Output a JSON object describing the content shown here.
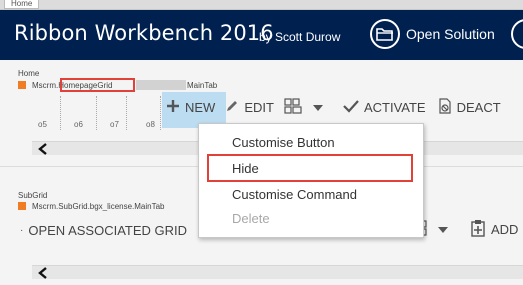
{
  "browser_tab": {
    "label": "Home"
  },
  "header": {
    "title": "Ribbon Workbench 2016",
    "byline": "by Scott Durow",
    "open_solution_label": "Open Solution"
  },
  "home_section": {
    "label": "Home",
    "id_prefix": "Mscrm.",
    "id_highlight": "HomepageGrid",
    "id_suffix": "MainTab",
    "columns": [
      "o5",
      "o6",
      "o7",
      "o8"
    ],
    "buttons": {
      "new": "NEW",
      "edit": "EDIT",
      "activate": "ACTIVATE",
      "deactivate": "DEACT"
    }
  },
  "subgrid_section": {
    "label": "SubGrid",
    "id": "Mscrm.SubGrid.bgx_license.MainTab",
    "buttons": {
      "open_associated": "OPEN ASSOCIATED GRID",
      "add": "ADD"
    }
  },
  "context_menu": {
    "items": [
      {
        "label": "Customise Button",
        "enabled": true
      },
      {
        "label": "Hide",
        "enabled": true
      },
      {
        "label": "Customise Command",
        "enabled": true
      },
      {
        "label": "Delete",
        "enabled": false
      }
    ]
  },
  "colors": {
    "header_bg": "#002050",
    "highlight_red": "#e0423a",
    "orange": "#f07c24",
    "new_button_hover": "#bcdcf2"
  }
}
